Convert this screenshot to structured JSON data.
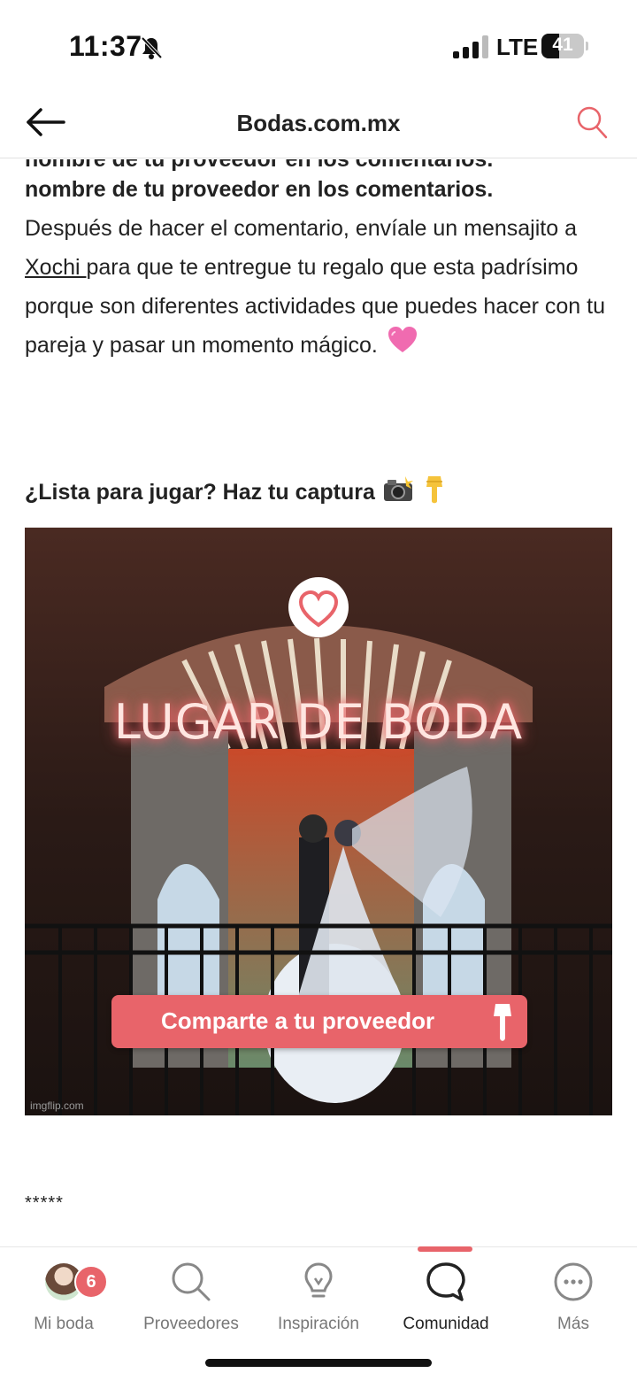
{
  "status_bar": {
    "time": "11:37",
    "network": "LTE",
    "battery": "41"
  },
  "header": {
    "title": "Bodas.com.mx"
  },
  "article": {
    "cut_line": "nombre de tu proveedor en los comentarios.",
    "bold_line": "nombre de tu proveedor en los comentarios.",
    "text_before_link": "Después de hacer el comentario, envíale un mensajito a ",
    "link_text": "Xochi ",
    "text_after_link": "para que te entregue tu regalo que esta padrísimo porque son diferentes actividades que puedes hacer con tu pareja y pasar un momento mágico.",
    "lead": "¿Lista para jugar? Haz tu captura",
    "image": {
      "title": "LUGAR DE BODA",
      "cta": "Comparte a tu proveedor",
      "watermark": "imgflip.com"
    },
    "stars": "*****"
  },
  "bottom_nav": {
    "items": [
      {
        "label": "Mi boda",
        "badge": "6"
      },
      {
        "label": "Proveedores"
      },
      {
        "label": "Inspiración"
      },
      {
        "label": "Comunidad"
      },
      {
        "label": "Más"
      }
    ],
    "active": "Comunidad"
  },
  "colors": {
    "accent": "#e8646a"
  }
}
